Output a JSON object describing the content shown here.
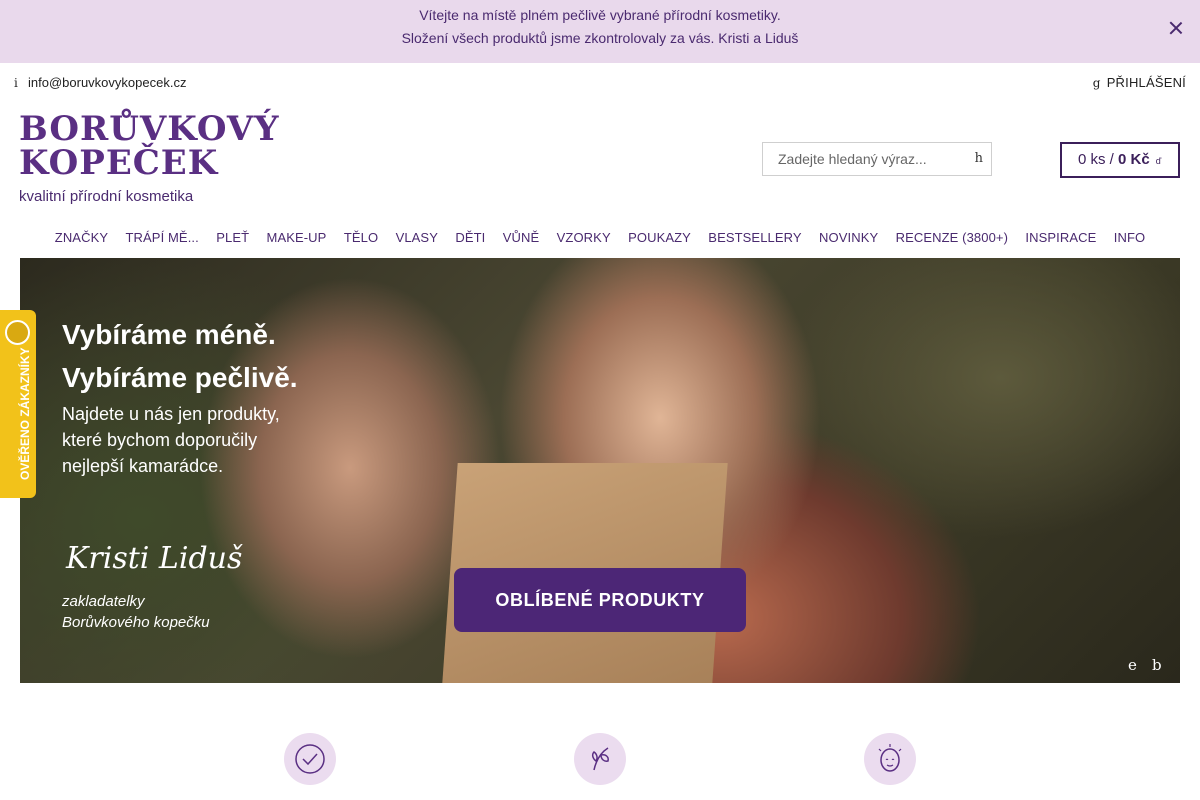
{
  "announcement": {
    "line1": " Vítejte na místě plném pečlivě vybrané přírodní kosmetiky.",
    "line2": "Složení všech produktů jsme zkontrolovaly za vás. Kristi a Liduš",
    "close_icon": "close-icon"
  },
  "topbar": {
    "email_icon_glyph": "i",
    "email": "info@boruvkovykopecek.cz",
    "login_icon_glyph": "g",
    "login": "PŘIHLÁŠENÍ"
  },
  "logo": {
    "line1": "BORŮVKOVÝ",
    "line2": "KOPEČEK",
    "tagline": "kvalitní přírodní kosmetika"
  },
  "search": {
    "placeholder": "Zadejte hledaný výraz...",
    "button_glyph": "h"
  },
  "wishlist": {
    "icon": "heart-icon",
    "glyph": ""
  },
  "cart": {
    "count": "0 ks",
    "separator": " / ",
    "total": "0 Kč",
    "arrow_glyph": "ď"
  },
  "nav": {
    "items": [
      "ZNAČKY",
      "TRÁPÍ MĚ...",
      "PLEŤ",
      "MAKE-UP",
      "TĚLO",
      "VLASY",
      "DĚTI",
      "VŮNĚ",
      "VZORKY",
      "POUKAZY",
      " BESTSELLERY",
      "NOVINKY",
      "RECENZE (3800+)",
      "INSPIRACE",
      "INFO"
    ]
  },
  "hero": {
    "headline1": "Vybíráme méně.",
    "headline2": "Vybíráme pečlivě.",
    "text1": "Najdete u nás jen produkty,",
    "text2": "které bychom doporučily",
    "text3": "nejlepší kamarádce.",
    "signature": "Kristi Liduš",
    "founders1": "zakladatelky",
    "founders2": "Borůvkového kopečku",
    "cta": "OBLÍBENÉ PRODUKTY",
    "prev_glyph": "e",
    "next_glyph": "b"
  },
  "verified": {
    "label": "OVĚŘENO ZÁKAZNÍKY"
  },
  "features": [
    {
      "icon": "checkmark-circle-icon"
    },
    {
      "icon": "leaf-icon"
    },
    {
      "icon": "face-care-icon"
    }
  ],
  "colors": {
    "brand_purple": "#5a2f83",
    "announcement_bg": "#e9d9ec",
    "cta_bg": "#4c2676",
    "verified_badge": "#f2c21a",
    "feature_circle": "#ebdcef"
  }
}
